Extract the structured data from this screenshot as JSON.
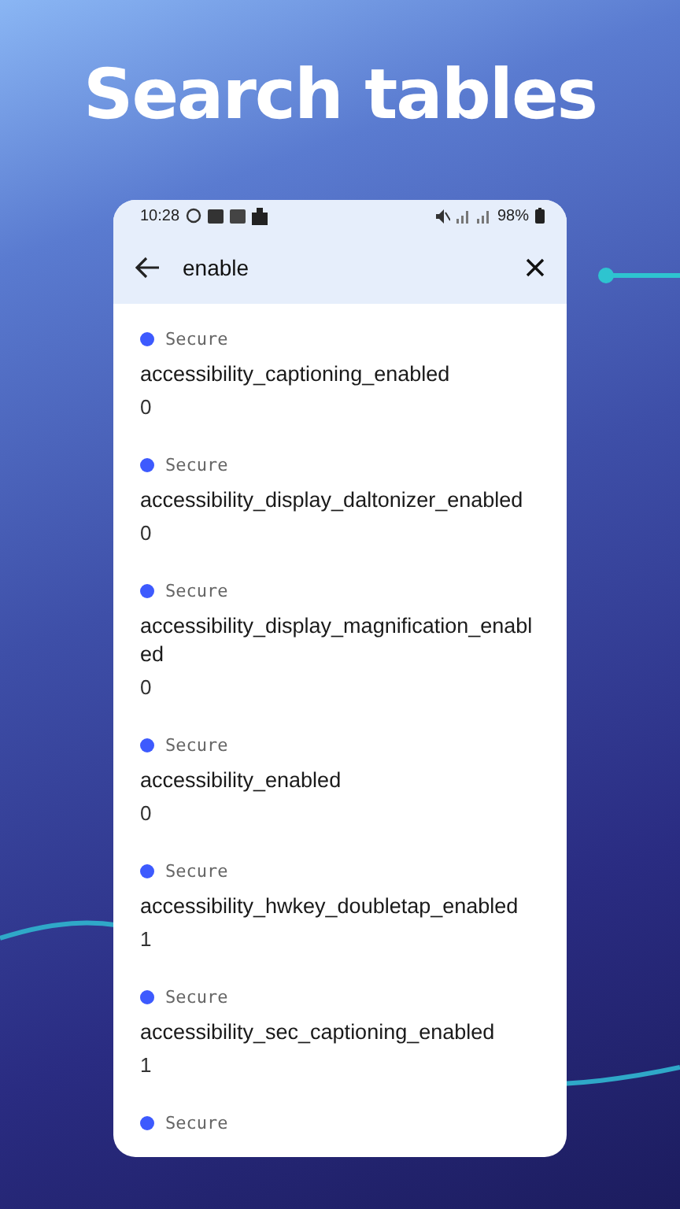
{
  "headline": "Search tables",
  "status_bar": {
    "time": "10:28",
    "battery": "98%"
  },
  "search": {
    "value": "enable"
  },
  "results": [
    {
      "category": "Secure",
      "color": "#3d5afe",
      "name": "accessibility_captioning_enabled",
      "value": "0"
    },
    {
      "category": "Secure",
      "color": "#3d5afe",
      "name": "accessibility_display_daltonizer_enabled",
      "value": "0"
    },
    {
      "category": "Secure",
      "color": "#3d5afe",
      "name": "accessibility_display_magnification_enabled",
      "value": "0"
    },
    {
      "category": "Secure",
      "color": "#3d5afe",
      "name": "accessibility_enabled",
      "value": "0"
    },
    {
      "category": "Secure",
      "color": "#3d5afe",
      "name": "accessibility_hwkey_doubletap_enabled",
      "value": "1"
    },
    {
      "category": "Secure",
      "color": "#3d5afe",
      "name": "accessibility_sec_captioning_enabled",
      "value": "1"
    },
    {
      "category": "Secure",
      "color": "#3d5afe"
    }
  ]
}
